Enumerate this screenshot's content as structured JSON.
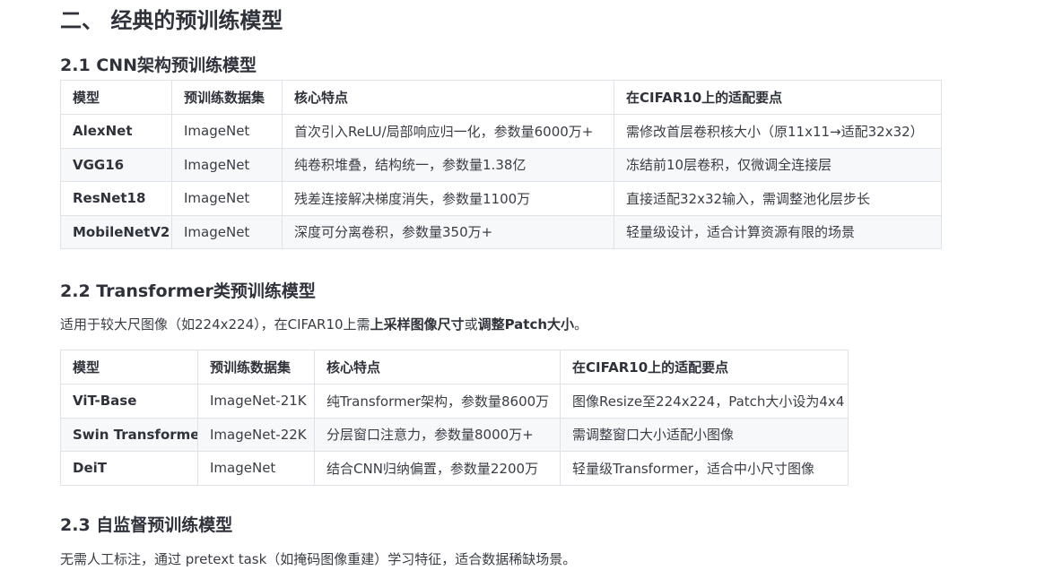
{
  "section_title": "二、 经典的预训练模型",
  "cnn": {
    "heading": "2.1 CNN架构预训练模型",
    "columns": [
      "模型",
      "预训练数据集",
      "核心特点",
      "在CIFAR10上的适配要点"
    ],
    "rows": [
      [
        "AlexNet",
        "ImageNet",
        "首次引入ReLU/局部响应归一化，参数量6000万+",
        "需修改首层卷积核大小（原11x11→适配32x32）"
      ],
      [
        "VGG16",
        "ImageNet",
        "纯卷积堆叠，结构统一，参数量1.38亿",
        "冻结前10层卷积，仅微调全连接层"
      ],
      [
        "ResNet18",
        "ImageNet",
        "残差连接解决梯度消失，参数量1100万",
        "直接适配32x32输入，需调整池化层步长"
      ],
      [
        "MobileNetV2",
        "ImageNet",
        "深度可分离卷积，参数量350万+",
        "轻量级设计，适合计算资源有限的场景"
      ]
    ]
  },
  "transformer": {
    "heading": "2.2 Transformer类预训练模型",
    "desc_prefix": "适用于较大尺图像（如224x224），在CIFAR10上需",
    "desc_bold1": "上采样图像尺寸",
    "desc_mid": "或",
    "desc_bold2": "调整Patch大小",
    "desc_suffix": "。",
    "columns": [
      "模型",
      "预训练数据集",
      "核心特点",
      "在CIFAR10上的适配要点"
    ],
    "rows": [
      [
        "ViT-Base",
        "ImageNet-21K",
        "纯Transformer架构，参数量8600万",
        "图像Resize至224x224，Patch大小设为4x4"
      ],
      [
        "Swin Transformer",
        "ImageNet-22K",
        "分层窗口注意力，参数量8000万+",
        "需调整窗口大小适配小图像"
      ],
      [
        "DeiT",
        "ImageNet",
        "结合CNN归纳偏置，参数量2200万",
        "轻量级Transformer，适合中小尺寸图像"
      ]
    ]
  },
  "selfsup": {
    "heading": "2.3 自监督预训练模型",
    "desc": "无需人工标注，通过 pretext task（如掩码图像重建）学习特征，适合数据稀缺场景。"
  }
}
